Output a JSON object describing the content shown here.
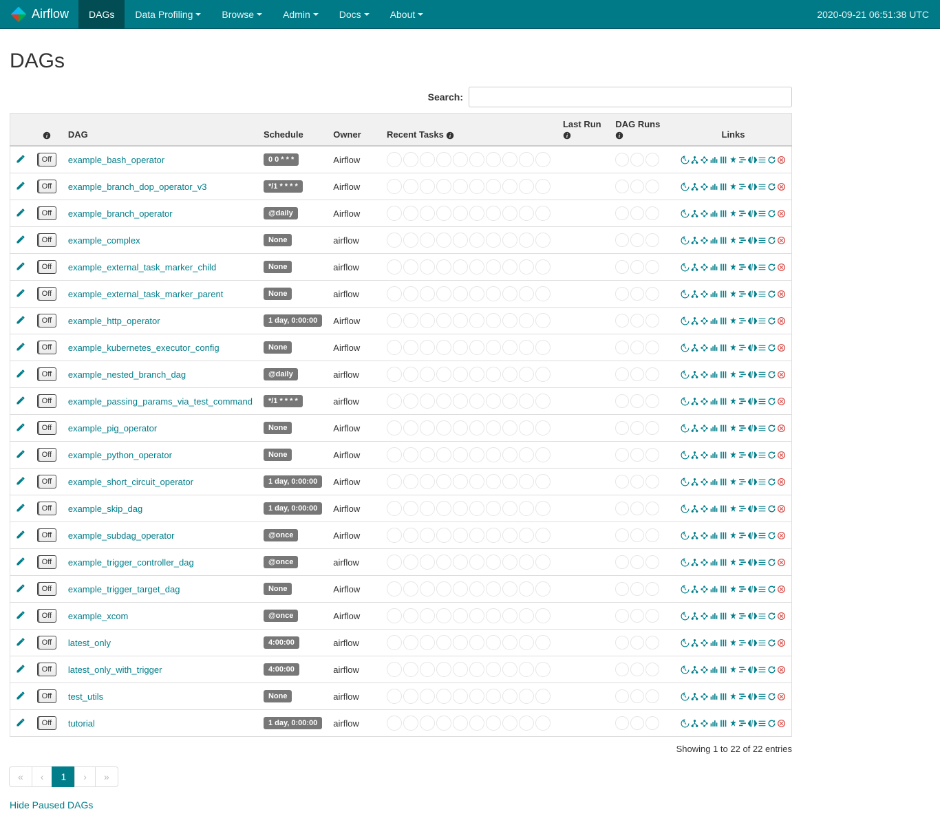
{
  "navbar": {
    "brand": "Airflow",
    "items": [
      {
        "label": "DAGs",
        "active": true,
        "dropdown": false
      },
      {
        "label": "Data Profiling",
        "active": false,
        "dropdown": true
      },
      {
        "label": "Browse",
        "active": false,
        "dropdown": true
      },
      {
        "label": "Admin",
        "active": false,
        "dropdown": true
      },
      {
        "label": "Docs",
        "active": false,
        "dropdown": true
      },
      {
        "label": "About",
        "active": false,
        "dropdown": true
      }
    ],
    "clock": "2020-09-21 06:51:38 UTC"
  },
  "page_title": "DAGs",
  "search_label": "Search:",
  "search_value": "",
  "toggle_off_label": "Off",
  "columns": {
    "info": "",
    "dag": "DAG",
    "schedule": "Schedule",
    "owner": "Owner",
    "recent_tasks": "Recent Tasks",
    "last_run": "Last Run",
    "dag_runs": "DAG Runs",
    "links": "Links"
  },
  "rows": [
    {
      "dag": "example_bash_operator",
      "schedule": "0 0 * * *",
      "owner": "Airflow"
    },
    {
      "dag": "example_branch_dop_operator_v3",
      "schedule": "*/1 * * * *",
      "owner": "Airflow"
    },
    {
      "dag": "example_branch_operator",
      "schedule": "@daily",
      "owner": "Airflow"
    },
    {
      "dag": "example_complex",
      "schedule": "None",
      "owner": "airflow"
    },
    {
      "dag": "example_external_task_marker_child",
      "schedule": "None",
      "owner": "airflow"
    },
    {
      "dag": "example_external_task_marker_parent",
      "schedule": "None",
      "owner": "airflow"
    },
    {
      "dag": "example_http_operator",
      "schedule": "1 day, 0:00:00",
      "owner": "Airflow"
    },
    {
      "dag": "example_kubernetes_executor_config",
      "schedule": "None",
      "owner": "Airflow"
    },
    {
      "dag": "example_nested_branch_dag",
      "schedule": "@daily",
      "owner": "airflow"
    },
    {
      "dag": "example_passing_params_via_test_command",
      "schedule": "*/1 * * * *",
      "owner": "airflow"
    },
    {
      "dag": "example_pig_operator",
      "schedule": "None",
      "owner": "Airflow"
    },
    {
      "dag": "example_python_operator",
      "schedule": "None",
      "owner": "Airflow"
    },
    {
      "dag": "example_short_circuit_operator",
      "schedule": "1 day, 0:00:00",
      "owner": "Airflow"
    },
    {
      "dag": "example_skip_dag",
      "schedule": "1 day, 0:00:00",
      "owner": "Airflow"
    },
    {
      "dag": "example_subdag_operator",
      "schedule": "@once",
      "owner": "Airflow"
    },
    {
      "dag": "example_trigger_controller_dag",
      "schedule": "@once",
      "owner": "airflow"
    },
    {
      "dag": "example_trigger_target_dag",
      "schedule": "None",
      "owner": "Airflow"
    },
    {
      "dag": "example_xcom",
      "schedule": "@once",
      "owner": "Airflow"
    },
    {
      "dag": "latest_only",
      "schedule": "4:00:00",
      "owner": "airflow"
    },
    {
      "dag": "latest_only_with_trigger",
      "schedule": "4:00:00",
      "owner": "airflow"
    },
    {
      "dag": "test_utils",
      "schedule": "None",
      "owner": "airflow"
    },
    {
      "dag": "tutorial",
      "schedule": "1 day, 0:00:00",
      "owner": "airflow"
    }
  ],
  "showing": "Showing 1 to 22 of 22 entries",
  "pagination": {
    "first": "«",
    "prev": "‹",
    "page": "1",
    "next": "›",
    "last": "»"
  },
  "hide_paused": "Hide Paused DAGs"
}
